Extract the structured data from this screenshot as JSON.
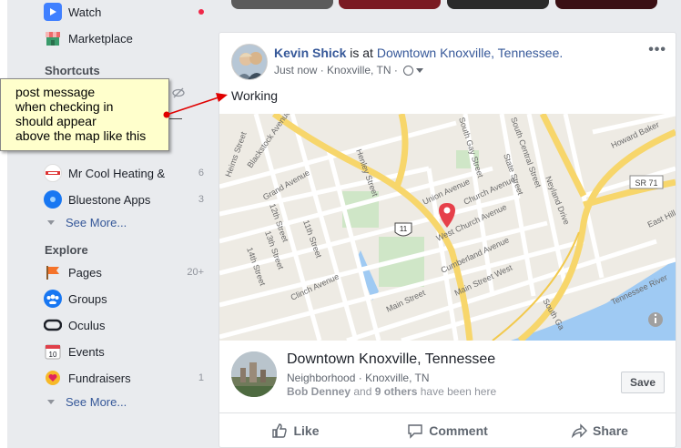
{
  "sidebar": {
    "watch": {
      "label": "Watch"
    },
    "marketplace": {
      "label": "Marketplace"
    },
    "shortcuts_title": "Shortcuts",
    "shortcuts": [
      {
        "label": "Mr Cool Heating &",
        "count": "6"
      },
      {
        "label": "Bluestone Apps",
        "count": "3"
      }
    ],
    "see_more_1": "See More...",
    "explore_title": "Explore",
    "explore": [
      {
        "label": "Pages",
        "count": "20+",
        "icon": "flag-icon"
      },
      {
        "label": "Groups",
        "count": "",
        "icon": "groups-icon"
      },
      {
        "label": "Oculus",
        "count": "",
        "icon": "oculus-icon"
      },
      {
        "label": "Events",
        "count": "",
        "icon": "calendar-icon",
        "calendar_day": "10"
      },
      {
        "label": "Fundraisers",
        "count": "1",
        "icon": "heart-coin-icon"
      }
    ],
    "see_more_2": "See More..."
  },
  "callout": {
    "lines": [
      "post message",
      "when checking in",
      "should appear",
      "above the map like this"
    ]
  },
  "post": {
    "author": "Kevin Shick",
    "is_at": " is at ",
    "place": "Downtown Knoxville, Tennessee.",
    "time": "Just now",
    "separator": " · ",
    "location": "Knoxville, TN",
    "message": "Working",
    "more": "•••"
  },
  "map": {
    "streets": [
      "Blackstock Avenue",
      "Heims Street",
      "Grand Avenue",
      "Henley Street",
      "12th Street",
      "11th Street",
      "13th Street",
      "14th Street",
      "Clinch Avenue",
      "South Gay Street",
      "Union Avenue",
      "Church Avenue",
      "West Church Avenue",
      "Cumberland Avenue",
      "Main Street",
      "Main Street West",
      "South Central Street",
      "State Street",
      "Neyland Drive",
      "Howard Baker",
      "East Hill",
      "Tennessee River",
      "SR 71",
      "11",
      "South Ga"
    ],
    "water_color": "#9fcaf3",
    "land_color": "#f0ede6",
    "highway_color": "#f7d66b"
  },
  "place_card": {
    "title": "Downtown Knoxville, Tennessee",
    "category": "Neighborhood",
    "separator": " · ",
    "city": "Knoxville, TN",
    "friend": "Bob Denney",
    "and": " and ",
    "others": "9 others",
    "tail": " have been here",
    "save_label": "Save"
  },
  "actions": {
    "like": "Like",
    "comment": "Comment",
    "share": "Share"
  },
  "colors": {
    "link": "#365899",
    "accent_red": "#e0245e",
    "callout_bg": "#ffffcc",
    "arrow": "#e00000"
  }
}
